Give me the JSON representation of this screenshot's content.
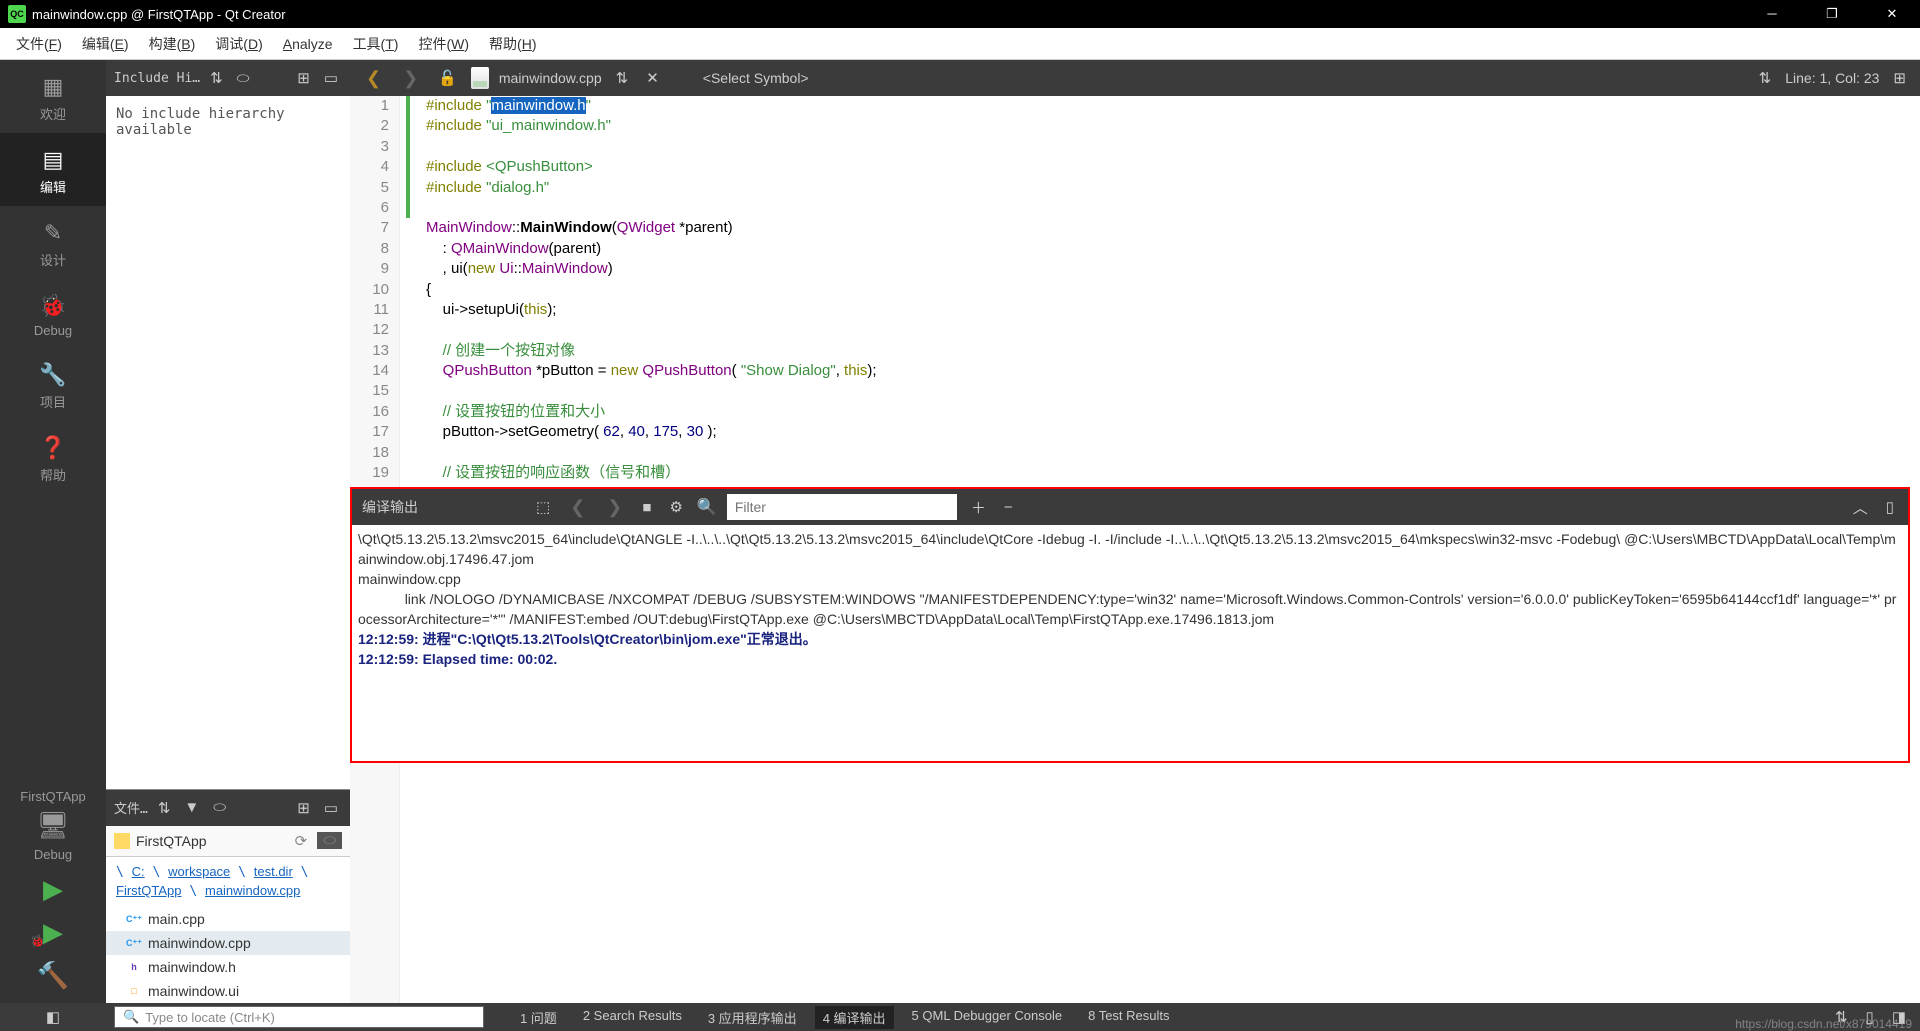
{
  "title": "mainwindow.cpp @ FirstQTApp - Qt Creator",
  "menubar": [
    "文件(F)",
    "编辑(E)",
    "构建(B)",
    "调试(D)",
    "Analyze",
    "工具(T)",
    "控件(W)",
    "帮助(H)"
  ],
  "nav": [
    {
      "label": "欢迎",
      "icon": "grid"
    },
    {
      "label": "编辑",
      "icon": "doc",
      "selected": true
    },
    {
      "label": "设计",
      "icon": "pencil"
    },
    {
      "label": "Debug",
      "icon": "bug"
    },
    {
      "label": "项目",
      "icon": "wrench"
    },
    {
      "label": "帮助",
      "icon": "question"
    }
  ],
  "include_panel": {
    "dropdown": "Include Hi…",
    "message": "No include hierarchy available"
  },
  "file_panel": {
    "dropdown": "文件…",
    "folder": "FirstQTApp",
    "breadcrumb": "\\ C: \\ workspace \\ test.dir \\ FirstQTApp \\ mainwindow.cpp",
    "files": [
      {
        "name": "main.cpp",
        "type": "cpp"
      },
      {
        "name": "mainwindow.cpp",
        "type": "cpp",
        "selected": true
      },
      {
        "name": "mainwindow.h",
        "type": "h"
      },
      {
        "name": "mainwindow.ui",
        "type": "ui"
      }
    ]
  },
  "editor": {
    "filename": "mainwindow.cpp",
    "symbol": "<Select Symbol>",
    "line_col": "Line: 1, Col: 23",
    "lines": [
      {
        "n": 1,
        "active": true,
        "html": "<span class='kw'>#include</span> <span class='str'>\"</span><span class='sel-highlight'>mainwindow.h</span><span class='str'>\"</span>"
      },
      {
        "n": 2,
        "active": true,
        "html": "<span class='kw'>#include</span> <span class='str'>\"ui_mainwindow.h\"</span>"
      },
      {
        "n": 3,
        "active": true,
        "html": ""
      },
      {
        "n": 4,
        "active": true,
        "html": "<span class='kw'>#include</span> <span class='str'>&lt;QPushButton&gt;</span>"
      },
      {
        "n": 5,
        "active": true,
        "html": "<span class='kw'>#include</span> <span class='str'>\"dialog.h\"</span>"
      },
      {
        "n": 6,
        "active": true,
        "html": ""
      },
      {
        "n": 7,
        "active": false,
        "html": "<span class='type'>MainWindow</span>::<span style='font-weight:bold'>MainWindow</span>(<span class='type'>QWidget</span> *parent)"
      },
      {
        "n": 8,
        "active": false,
        "html": "    : <span class='type'>QMainWindow</span>(parent)"
      },
      {
        "n": 9,
        "active": false,
        "html": "    , ui(<span class='kw'>new</span> <span class='type'>Ui</span>::<span class='type'>MainWindow</span>)"
      },
      {
        "n": 10,
        "active": false,
        "html": "{"
      },
      {
        "n": 11,
        "active": false,
        "html": "    ui-&gt;setupUi(<span class='kw'>this</span>);"
      },
      {
        "n": 12,
        "active": false,
        "html": ""
      },
      {
        "n": 13,
        "active": false,
        "html": "    <span class='comment'>// 创建一个按钮对像</span>"
      },
      {
        "n": 14,
        "active": false,
        "html": "    <span class='type'>QPushButton</span> *pButton = <span class='kw'>new</span> <span class='type'>QPushButton</span>( <span class='str'>\"Show Dialog\"</span>, <span class='kw'>this</span>);"
      },
      {
        "n": 15,
        "active": false,
        "html": ""
      },
      {
        "n": 16,
        "active": false,
        "html": "    <span class='comment'>// 设置按钮的位置和大小</span>"
      },
      {
        "n": 17,
        "active": false,
        "html": "    pButton-&gt;setGeometry( <span class='num'>62</span>, <span class='num'>40</span>, <span class='num'>175</span>, <span class='num'>30</span> );"
      },
      {
        "n": 18,
        "active": false,
        "html": ""
      },
      {
        "n": 19,
        "active": false,
        "html": "    <span class='comment'>// 设置按钮的响应函数（信号和槽）</span>"
      }
    ]
  },
  "output": {
    "title": "编译输出",
    "filter_placeholder": "Filter",
    "lines": [
      {
        "cls": "out-normal",
        "text": "\\Qt\\Qt5.13.2\\5.13.2\\msvc2015_64\\include\\QtANGLE -I..\\..\\..\\Qt\\Qt5.13.2\\5.13.2\\msvc2015_64\\include\\QtCore -Idebug -I. -I/include -I..\\..\\..\\Qt\\Qt5.13.2\\5.13.2\\msvc2015_64\\mkspecs\\win32-msvc -Fodebug\\ @C:\\Users\\MBCTD\\AppData\\Local\\Temp\\mainwindow.obj.17496.47.jom"
      },
      {
        "cls": "out-normal",
        "text": "mainwindow.cpp"
      },
      {
        "cls": "out-normal",
        "text": "            link /NOLOGO /DYNAMICBASE /NXCOMPAT /DEBUG /SUBSYSTEM:WINDOWS \"/MANIFESTDEPENDENCY:type='win32' name='Microsoft.Windows.Common-Controls' version='6.0.0.0' publicKeyToken='6595b64144ccf1df' language='*' processorArchitecture='*'\" /MANIFEST:embed /OUT:debug\\FirstQTApp.exe @C:\\Users\\MBCTD\\AppData\\Local\\Temp\\FirstQTApp.exe.17496.1813.jom"
      },
      {
        "cls": "out-bold",
        "text": "12:12:59: 进程\"C:\\Qt\\Qt5.13.2\\Tools\\QtCreator\\bin\\jom.exe\"正常退出。"
      },
      {
        "cls": "out-bold",
        "text": "12:12:59: Elapsed time: 00:02."
      }
    ]
  },
  "status": {
    "locate_placeholder": "Type to locate (Ctrl+K)",
    "panes": [
      {
        "n": "1",
        "label": "问题"
      },
      {
        "n": "2",
        "label": "Search Results"
      },
      {
        "n": "3",
        "label": "应用程序输出"
      },
      {
        "n": "4",
        "label": "编译输出",
        "active": true
      },
      {
        "n": "5",
        "label": "QML Debugger Console"
      },
      {
        "n": "8",
        "label": "Test Results"
      }
    ]
  },
  "project": {
    "name": "FirstQTApp",
    "config": "Debug"
  },
  "watermark": "https://blog.csdn.net/x879014419"
}
